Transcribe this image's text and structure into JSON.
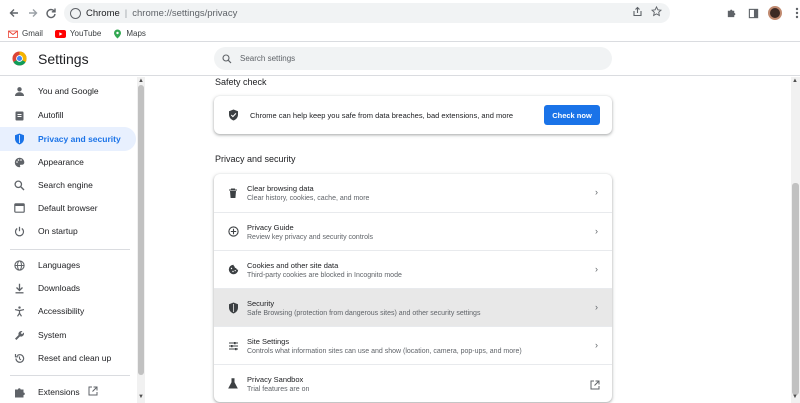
{
  "browser": {
    "site": "Chrome",
    "url_path": "chrome://settings/privacy",
    "bookmarks": [
      {
        "label": "Gmail"
      },
      {
        "label": "YouTube"
      },
      {
        "label": "Maps"
      }
    ]
  },
  "header": {
    "title": "Settings",
    "search_placeholder": "Search settings"
  },
  "sidebar": {
    "items": [
      {
        "label": "You and Google",
        "icon": "person-icon"
      },
      {
        "label": "Autofill",
        "icon": "clipboard-icon"
      },
      {
        "label": "Privacy and security",
        "icon": "shield-icon",
        "active": true
      },
      {
        "label": "Appearance",
        "icon": "palette-icon"
      },
      {
        "label": "Search engine",
        "icon": "search-icon"
      },
      {
        "label": "Default browser",
        "icon": "browser-icon"
      },
      {
        "label": "On startup",
        "icon": "power-icon"
      },
      {
        "label": "Languages",
        "icon": "globe-icon"
      },
      {
        "label": "Downloads",
        "icon": "download-icon"
      },
      {
        "label": "Accessibility",
        "icon": "accessibility-icon"
      },
      {
        "label": "System",
        "icon": "wrench-icon"
      },
      {
        "label": "Reset and clean up",
        "icon": "reset-icon"
      },
      {
        "label": "Extensions",
        "icon": "puzzle-icon"
      }
    ]
  },
  "safety_check": {
    "title": "Safety check",
    "text": "Chrome can help keep you safe from data breaches, bad extensions, and more",
    "button": "Check now"
  },
  "privacy": {
    "title": "Privacy and security",
    "rows": [
      {
        "title": "Clear browsing data",
        "subtitle": "Clear history, cookies, cache, and more",
        "icon": "trash-icon"
      },
      {
        "title": "Privacy Guide",
        "subtitle": "Review key privacy and security controls",
        "icon": "compass-icon"
      },
      {
        "title": "Cookies and other site data",
        "subtitle": "Third-party cookies are blocked in Incognito mode",
        "icon": "cookie-icon"
      },
      {
        "title": "Security",
        "subtitle": "Safe Browsing (protection from dangerous sites) and other security settings",
        "icon": "shield-icon"
      },
      {
        "title": "Site Settings",
        "subtitle": "Controls what information sites can use and show (location, camera, pop-ups, and more)",
        "icon": "sliders-icon"
      },
      {
        "title": "Privacy Sandbox",
        "subtitle": "Trial features are on",
        "icon": "flask-icon"
      }
    ]
  },
  "colors": {
    "accent": "#1a73e8",
    "active_bg": "#e8f0fe",
    "hover_row": "#e8e8e8"
  }
}
